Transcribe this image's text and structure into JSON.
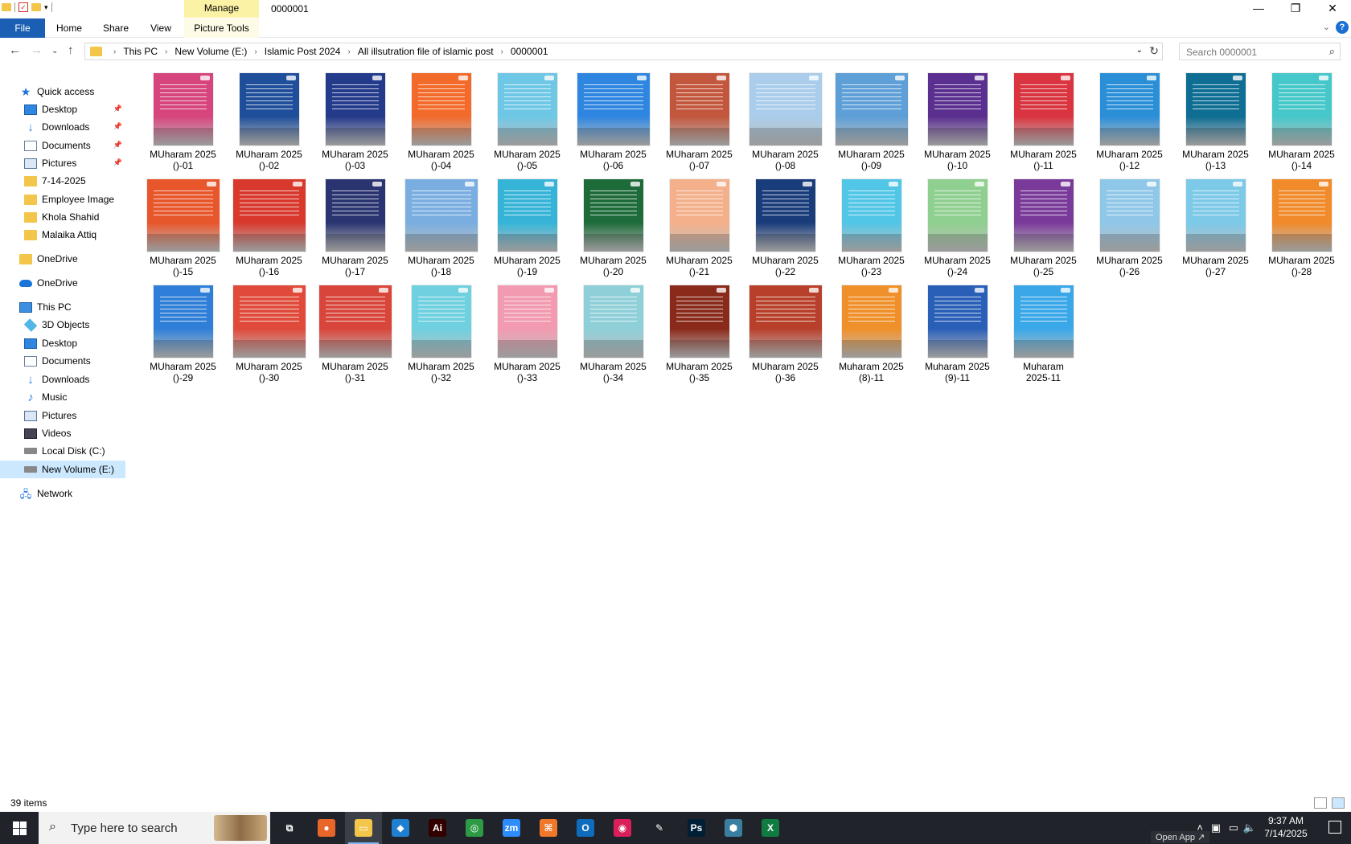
{
  "window": {
    "title": "0000001",
    "manage_tab": "Manage",
    "minimize": "—",
    "restore": "❐",
    "close": "✕"
  },
  "ribbon": {
    "file": "File",
    "home": "Home",
    "share": "Share",
    "view": "View",
    "picture_tools": "Picture Tools",
    "collapse": "⌄",
    "help": "?"
  },
  "address": {
    "crumbs": [
      "This PC",
      "New Volume (E:)",
      "Islamic Post 2024",
      "All illsutration file of islamic post",
      "0000001"
    ],
    "search_placeholder": "Search 0000001"
  },
  "nav": {
    "items": [
      {
        "label": "Quick access",
        "icon": "star-icon",
        "pinned": false
      },
      {
        "label": "Desktop",
        "icon": "desktop-icon",
        "pinned": true
      },
      {
        "label": "Downloads",
        "icon": "download-icon",
        "pinned": true
      },
      {
        "label": "Documents",
        "icon": "documents-icon",
        "pinned": true
      },
      {
        "label": "Pictures",
        "icon": "pictures-icon",
        "pinned": true
      },
      {
        "label": "7-14-2025",
        "icon": "folder-icon",
        "pinned": false
      },
      {
        "label": "Employee Image",
        "icon": "folder-icon",
        "pinned": false
      },
      {
        "label": "Khola Shahid",
        "icon": "folder-icon",
        "pinned": false
      },
      {
        "label": "Malaika Attiq",
        "icon": "folder-icon",
        "pinned": false
      },
      {
        "label": "OneDrive",
        "icon": "folder-icon",
        "pinned": false
      },
      {
        "label": "OneDrive",
        "icon": "onedrive-icon",
        "pinned": false
      },
      {
        "label": "This PC",
        "icon": "this-pc-icon",
        "pinned": false
      },
      {
        "label": "3D Objects",
        "icon": "3d-objects-icon",
        "pinned": false
      },
      {
        "label": "Desktop",
        "icon": "desktop-icon",
        "pinned": false
      },
      {
        "label": "Documents",
        "icon": "documents-icon",
        "pinned": false
      },
      {
        "label": "Downloads",
        "icon": "download-icon",
        "pinned": false
      },
      {
        "label": "Music",
        "icon": "music-icon",
        "pinned": false
      },
      {
        "label": "Pictures",
        "icon": "pictures-icon",
        "pinned": false
      },
      {
        "label": "Videos",
        "icon": "videos-icon",
        "pinned": false
      },
      {
        "label": "Local Disk (C:)",
        "icon": "drive-icon",
        "pinned": false
      },
      {
        "label": "New Volume (E:)",
        "icon": "drive-icon",
        "pinned": false,
        "selected": true
      },
      {
        "label": "Network",
        "icon": "network-icon",
        "pinned": false
      }
    ]
  },
  "files": [
    {
      "line1": "MUharam 2025",
      "line2": "()-01",
      "color": "#d6457e"
    },
    {
      "line1": "MUharam 2025",
      "line2": "()-02",
      "color": "#1f4f9a"
    },
    {
      "line1": "MUharam 2025",
      "line2": "()-03",
      "color": "#243a8a"
    },
    {
      "line1": "MUharam 2025",
      "line2": "()-04",
      "color": "#f36b2b"
    },
    {
      "line1": "MUharam 2025",
      "line2": "()-05",
      "color": "#6fc7e6"
    },
    {
      "line1": "MUharam 2025",
      "line2": "()-06",
      "color": "#2f86e0"
    },
    {
      "line1": "MUharam 2025",
      "line2": "()-07",
      "color": "#c2573d"
    },
    {
      "line1": "MUharam 2025",
      "line2": "()-08",
      "color": "#a9cdea"
    },
    {
      "line1": "MUharam 2025",
      "line2": "()-09",
      "color": "#5e9fd8"
    },
    {
      "line1": "MUharam 2025",
      "line2": "()-10",
      "color": "#5a2f8f"
    },
    {
      "line1": "MUharam 2025",
      "line2": "()-11",
      "color": "#d9343f"
    },
    {
      "line1": "MUharam 2025",
      "line2": "()-12",
      "color": "#2b8fd8"
    },
    {
      "line1": "MUharam 2025",
      "line2": "()-13",
      "color": "#0f6e93"
    },
    {
      "line1": "MUharam 2025",
      "line2": "()-14",
      "color": "#46c7c9"
    },
    {
      "line1": "MUharam 2025",
      "line2": "()-15",
      "color": "#e8562c"
    },
    {
      "line1": "MUharam 2025",
      "line2": "()-16",
      "color": "#d8392c"
    },
    {
      "line1": "MUharam 2025",
      "line2": "()-17",
      "color": "#2a3470"
    },
    {
      "line1": "MUharam 2025",
      "line2": "()-18",
      "color": "#7aaee0"
    },
    {
      "line1": "MUharam 2025",
      "line2": "()-19",
      "color": "#36b4d8"
    },
    {
      "line1": "MUharam 2025",
      "line2": "()-20",
      "color": "#1e6b3a"
    },
    {
      "line1": "MUharam 2025",
      "line2": "()-21",
      "color": "#f4b08a"
    },
    {
      "line1": "MUharam 2025",
      "line2": "()-22",
      "color": "#193c7a"
    },
    {
      "line1": "MUharam 2025",
      "line2": "()-23",
      "color": "#52c6e6"
    },
    {
      "line1": "MUharam 2025",
      "line2": "()-24",
      "color": "#8fcf8f"
    },
    {
      "line1": "MUharam 2025",
      "line2": "()-25",
      "color": "#7a3a9a"
    },
    {
      "line1": "MUharam 2025",
      "line2": "()-26",
      "color": "#8fc7e8"
    },
    {
      "line1": "MUharam 2025",
      "line2": "()-27",
      "color": "#7cc9e8"
    },
    {
      "line1": "MUharam 2025",
      "line2": "()-28",
      "color": "#f08a2a"
    },
    {
      "line1": "MUharam 2025",
      "line2": "()-29",
      "color": "#2f7fd8"
    },
    {
      "line1": "MUharam 2025",
      "line2": "()-30",
      "color": "#e04a3a"
    },
    {
      "line1": "MUharam 2025",
      "line2": "()-31",
      "color": "#d8453a"
    },
    {
      "line1": "MUharam 2025",
      "line2": "()-32",
      "color": "#6fd0e0"
    },
    {
      "line1": "MUharam 2025",
      "line2": "()-33",
      "color": "#f29ab0"
    },
    {
      "line1": "MUharam 2025",
      "line2": "()-34",
      "color": "#8ecfd8"
    },
    {
      "line1": "MUharam 2025",
      "line2": "()-35",
      "color": "#8a2a1a"
    },
    {
      "line1": "MUharam 2025",
      "line2": "()-36",
      "color": "#b8402a"
    },
    {
      "line1": "Muharam 2025",
      "line2": "(8)-11",
      "color": "#f0902a"
    },
    {
      "line1": "Muharam 2025",
      "line2": "(9)-11",
      "color": "#2a5fb8"
    },
    {
      "line1": "Muharam",
      "line2": "2025-11",
      "color": "#3aa8e8"
    }
  ],
  "status": {
    "item_count": "39 items"
  },
  "taskbar": {
    "search_placeholder": "Type here to search",
    "apps": [
      {
        "name": "task-view-icon",
        "label": "⧉",
        "color": "#20242a"
      },
      {
        "name": "firefox-icon",
        "label": "●",
        "color": "#e8662a"
      },
      {
        "name": "file-explorer-icon",
        "label": "▭",
        "color": "#f3c54a"
      },
      {
        "name": "vscode-icon",
        "label": "◆",
        "color": "#1f7fd1"
      },
      {
        "name": "illustrator-icon",
        "label": "Ai",
        "color": "#330000"
      },
      {
        "name": "chrome-icon",
        "label": "◎",
        "color": "#2d9b45"
      },
      {
        "name": "zoom-icon",
        "label": "zm",
        "color": "#2d8cff"
      },
      {
        "name": "app-orange-icon",
        "label": "⌘",
        "color": "#f0782a"
      },
      {
        "name": "outlook-icon",
        "label": "O",
        "color": "#0f6cbd"
      },
      {
        "name": "creative-cloud-icon",
        "label": "◉",
        "color": "#da1f5a"
      },
      {
        "name": "pen-tool-icon",
        "label": "✎",
        "color": "#20242a"
      },
      {
        "name": "photoshop-icon",
        "label": "Ps",
        "color": "#001e36"
      },
      {
        "name": "app-teal-icon",
        "label": "⬢",
        "color": "#3a7fa0"
      },
      {
        "name": "excel-icon",
        "label": "X",
        "color": "#107c41"
      }
    ],
    "open_app": "Open App ↗",
    "time": "9:37 AM",
    "date": "7/14/2025"
  }
}
